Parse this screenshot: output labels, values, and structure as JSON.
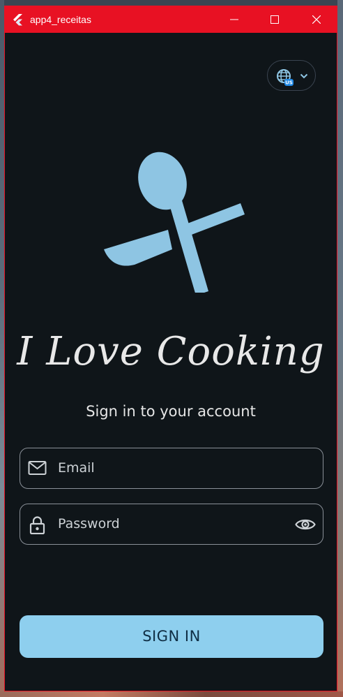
{
  "window": {
    "title": "app4_receitas",
    "accent_color": "#e81123",
    "background_color": "#0f1519"
  },
  "icons": {
    "app": "flutter-logo-icon",
    "minimize": "minimize-icon",
    "maximize": "maximize-icon",
    "close": "close-icon",
    "language": "globe-us-icon",
    "dropdown": "chevron-down-icon",
    "logo": "spoon-knife-icon",
    "email": "mail-icon",
    "password": "lock-icon",
    "visibility": "eye-icon"
  },
  "language": {
    "badge": "US"
  },
  "brand": {
    "name": "I Love Cooking",
    "logo_color": "#8ec5e3"
  },
  "login": {
    "subtitle": "Sign in to your account",
    "email_placeholder": "Email",
    "password_placeholder": "Password",
    "sign_in_label": "SIGN IN",
    "button_color": "#8ecfee"
  }
}
